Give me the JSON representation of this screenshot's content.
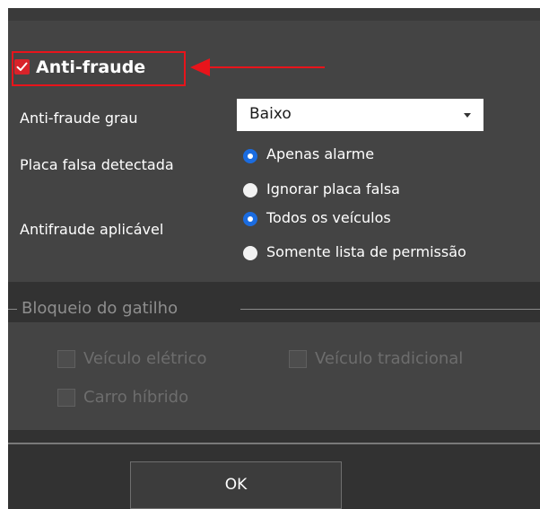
{
  "anti_fraude": {
    "label": "Anti-fraude",
    "checked": true
  },
  "grau": {
    "label": "Anti-fraude grau",
    "value": "Baixo"
  },
  "placa_falsa": {
    "label": "Placa falsa detectada",
    "options": [
      "Apenas alarme",
      "Ignorar placa falsa"
    ],
    "selected": "Apenas alarme"
  },
  "aplicavel": {
    "label": "Antifraude aplicável",
    "options": [
      "Todos os veículos",
      "Somente lista de permissão"
    ],
    "selected": "Todos os veículos"
  },
  "bloqueio": {
    "title": "Bloqueio do gatilho",
    "items": [
      "Veículo elétrico",
      "Veículo tradicional",
      "Carro híbrido"
    ],
    "disabled": true
  },
  "ok_label": "OK",
  "colors": {
    "highlight": "#e8141b",
    "radio_active": "#1b6ce0",
    "panel": "#444444",
    "background": "#323232"
  }
}
